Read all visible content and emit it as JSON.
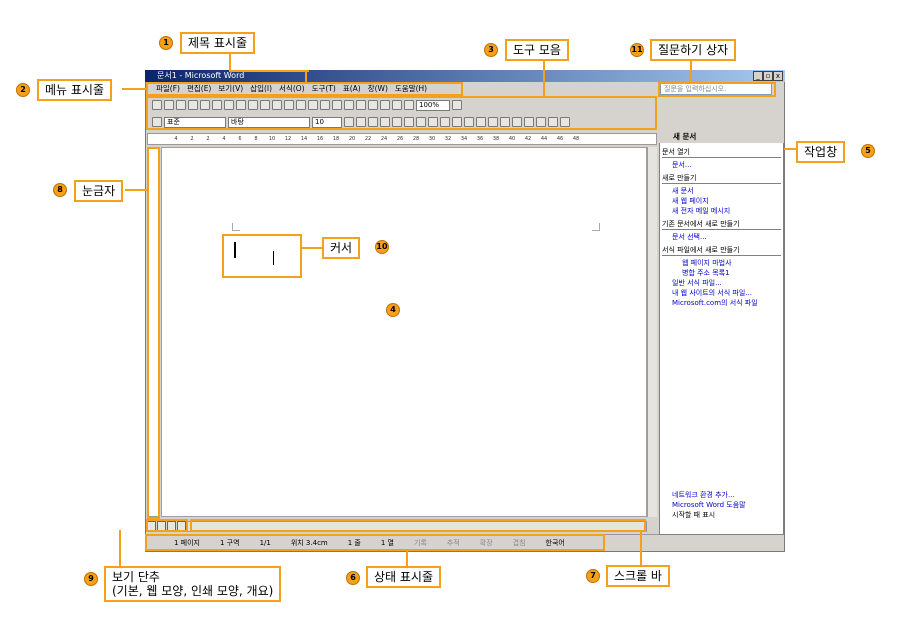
{
  "window": {
    "title": "문서1 - Microsoft Word",
    "controls": [
      "_",
      "▫",
      "x"
    ]
  },
  "menu": {
    "items": [
      "파일(F)",
      "편집(E)",
      "보기(V)",
      "삽입(I)",
      "서식(O)",
      "도구(T)",
      "표(A)",
      "창(W)",
      "도움말(H)"
    ],
    "question_placeholder": "질문을 입력하십시오."
  },
  "toolbar": {
    "zoom": "100%",
    "style": "표준",
    "font": "바탕",
    "size": "10"
  },
  "ruler": {
    "numbers": [
      "4",
      "2",
      "2",
      "4",
      "6",
      "8",
      "10",
      "12",
      "14",
      "16",
      "18",
      "20",
      "22",
      "24",
      "26",
      "28",
      "30",
      "32",
      "34",
      "36",
      "38",
      "40",
      "42",
      "44",
      "46",
      "48"
    ]
  },
  "taskpane": {
    "title": "새 문서",
    "sections": [
      {
        "header": "문서 열기",
        "links": [
          "문서..."
        ]
      },
      {
        "header": "새로 만들기",
        "links": [
          "새 문서",
          "새 웹 페이지",
          "새 전자 메일 메시지"
        ]
      },
      {
        "header": "기존 문서에서 새로 만들기",
        "links": [
          "문서 선택..."
        ]
      },
      {
        "header": "서식 파일에서 새로 만들기",
        "links": [
          "웹 페이지 마법사",
          "병합 주소 목록1",
          "일반 서식 파일...",
          "내 웹 사이트의 서식 파일...",
          "Microsoft.com의 서식 파일"
        ]
      }
    ],
    "footer": [
      "네트워크 환경 추가...",
      "Microsoft Word 도움말",
      "시작할 때 표시"
    ]
  },
  "status": {
    "page": "1 페이지",
    "section": "1 구역",
    "pages": "1/1",
    "position": "위치 3.4cm",
    "line": "1 줄",
    "col": "1 열",
    "rec": "기록",
    "trk": "추적",
    "ext": "확장",
    "ovr": "겹침",
    "lang": "한국어"
  },
  "callouts": {
    "c1": "제목 표시줄",
    "c2": "메뉴 표시줄",
    "c3": "도구 모음",
    "c4": "",
    "c5": "작업창",
    "c6": "상태 표시줄",
    "c7": "스크롤 바",
    "c8": "눈금자",
    "c9": "보기 단추\n(기본, 웹 모양, 인쇄 모양, 개요)",
    "c10": "커서",
    "c11": "질문하기 상자"
  },
  "numbers": {
    "n1": "1",
    "n2": "2",
    "n3": "3",
    "n4": "4",
    "n5": "5",
    "n6": "6",
    "n7": "7",
    "n8": "8",
    "n9": "9",
    "n10": "10",
    "n11": "11"
  }
}
